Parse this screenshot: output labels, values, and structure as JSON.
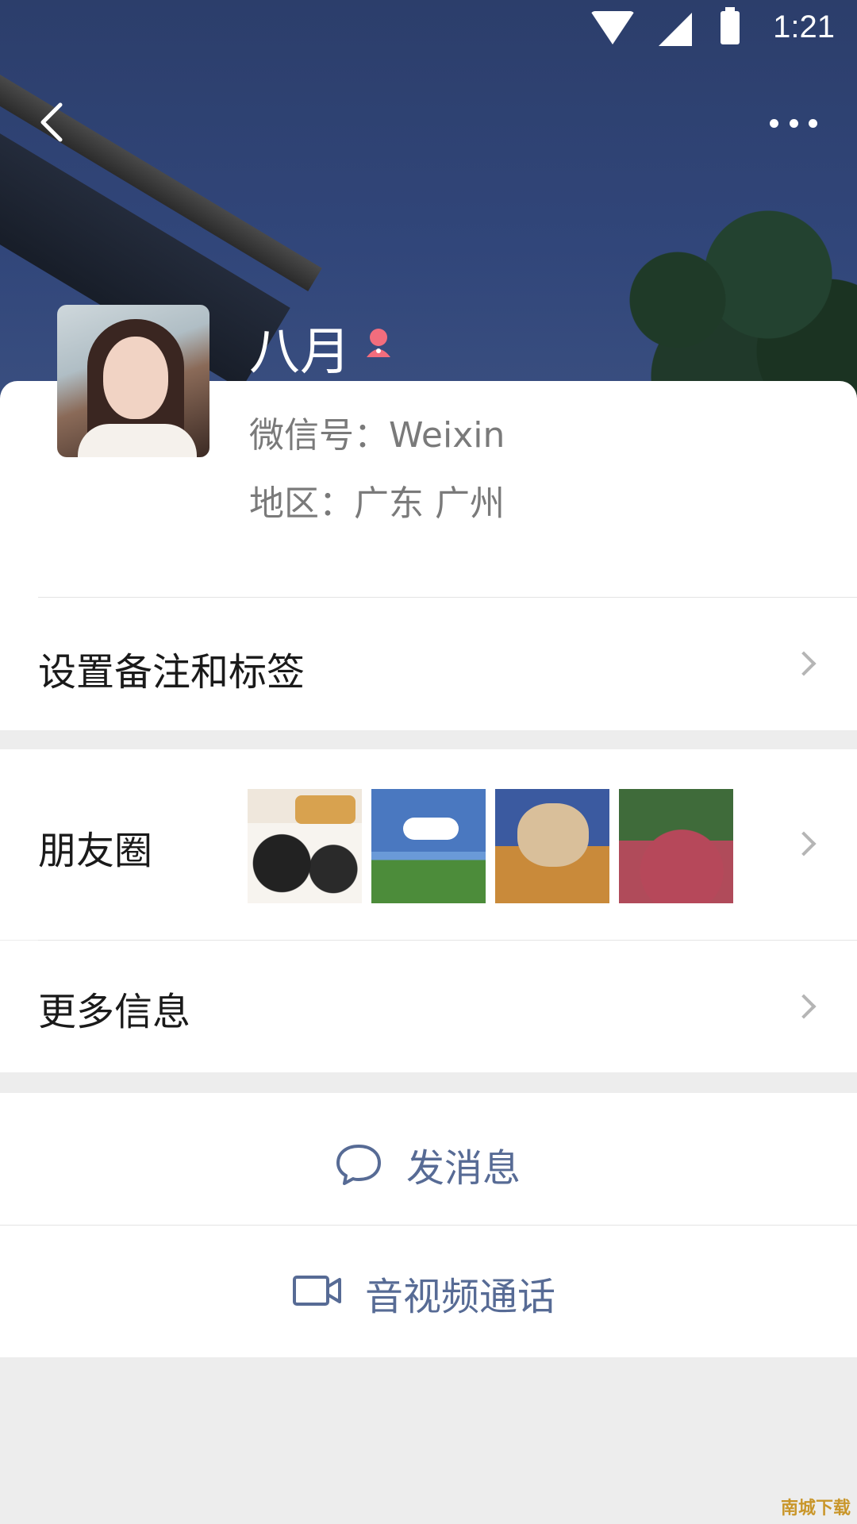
{
  "status_bar": {
    "time": "1:21"
  },
  "profile": {
    "name": "八月",
    "wechat_id_label": "微信号：",
    "wechat_id": "Weixin",
    "region_label": "地区：",
    "region": "广东 广州",
    "gender": "female"
  },
  "rows": {
    "remark_tags": "设置备注和标签",
    "moments": "朋友圈",
    "more_info": "更多信息"
  },
  "actions": {
    "send_message": "发消息",
    "video_call": "音视频通话"
  },
  "watermark": "南城下载",
  "colors": {
    "accent": "#576b95",
    "background": "#ededed",
    "gender_female": "#f26d7d"
  }
}
